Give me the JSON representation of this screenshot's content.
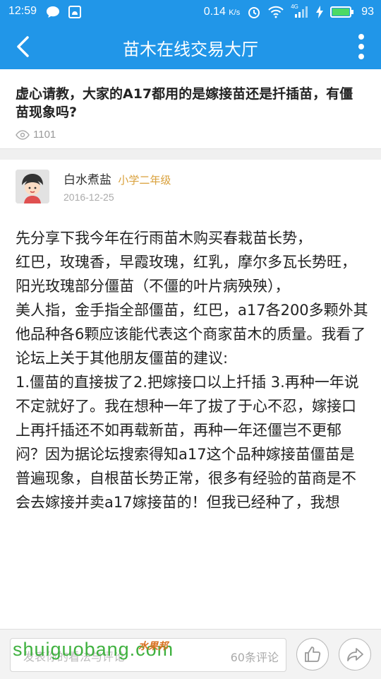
{
  "status_bar": {
    "time": "12:59",
    "speed": "0.14",
    "speed_unit": "K/s",
    "network": "4G",
    "battery": "93",
    "icons": [
      "chat-bubble-icon",
      "notification-square-icon",
      "alarm-icon",
      "wifi-icon",
      "signal-icon",
      "charging-icon",
      "battery-icon"
    ]
  },
  "app_bar": {
    "title": "苗木在线交易大厅",
    "back_icon": "back-arrow-icon",
    "menu_icon": "more-vertical-icon"
  },
  "question": {
    "title": "虚心请教，大家的A17都用的是嫁接苗还是扦插苗，有僵苗现象吗?",
    "views": "1101"
  },
  "post": {
    "author": "白水煮盐",
    "level": "小学二年级",
    "date": "2016-12-25",
    "content": "先分享下我今年在行雨苗木购买春栽苗长势，\n红巴，玫瑰香，早霞玫瑰，红乳，摩尔多瓦长势旺，阳光玫瑰部分僵苗（不僵的叶片病殃殃），\n美人指，金手指全部僵苗，红巴，a17各200多颗外其他品种各6颗应该能代表这个商家苗木的质量。我看了论坛上关于其他朋友僵苗的建议:\n1.僵苗的直接拔了2.把嫁接口以上扦插 3.再种一年说不定就好了。我在想种一年了拔了于心不忍，嫁接口上再扦插还不如再载新苗，再种一年还僵岂不更郁闷？因为据论坛搜索得知a17这个品种嫁接苗僵苗是普遍现象，自根苗长势正常，很多有经验的苗商是不会去嫁接并卖a17嫁接苗的！但我已经种了，我想"
  },
  "bottom_bar": {
    "comment_placeholder": "发表你的看法与评论",
    "comment_count": "60条评论",
    "like_icon": "thumbs-up-icon",
    "share_icon": "share-arrow-icon"
  },
  "watermark": {
    "site": "shuiguobang.com",
    "brand": "水果邦"
  },
  "colors": {
    "primary": "#2196e8",
    "level": "#d9a03a",
    "watermark": "#3fb13f"
  }
}
